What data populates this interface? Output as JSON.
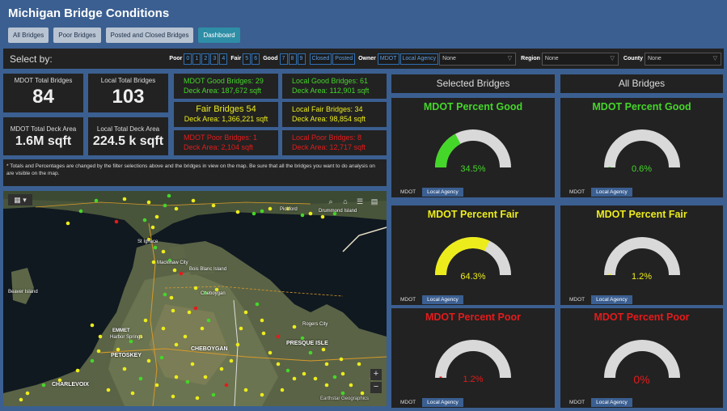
{
  "title": "Michigan Bridge Conditions",
  "tabs": [
    "All Bridges",
    "Poor Bridges",
    "Posted and Closed Bridges",
    "Dashboard"
  ],
  "select_bar": {
    "label": "Select by:",
    "poor_label": "Poor",
    "poor_values": [
      "0",
      "1",
      "2",
      "3",
      "4"
    ],
    "fair_label": "Fair",
    "fair_values": [
      "5",
      "6"
    ],
    "good_label": "Good",
    "good_values": [
      "7",
      "8",
      "9"
    ],
    "closed": "Closed",
    "posted": "Posted",
    "owner_label": "Owner",
    "owner_mdot": "MDOT",
    "owner_local": "Local Agency",
    "owner_select": "None",
    "region_label": "Region",
    "region_select": "None",
    "county_label": "County",
    "county_select": "None"
  },
  "stats": {
    "mdot_total_label": "MDOT Total Bridges",
    "mdot_total": "84",
    "local_total_label": "Local Total Bridges",
    "local_total": "103",
    "mdot_deck_label": "MDOT Total Deck Area",
    "mdot_deck": "1.6M sqft",
    "local_deck_label": "Local Total Deck Area",
    "local_deck": "224.5 k sqft"
  },
  "conditions": {
    "mdot_good": "MDOT Good Bridges: 29",
    "mdot_good_area": "Deck Area: 187,672 sqft",
    "local_good": "Local Good Bridges: 61",
    "local_good_area": "Deck Area: 112,901 sqft",
    "fair": "Fair Bridges 54",
    "fair_area": "Deck Area: 1,366,221 sqft",
    "local_fair": "Local Fair Bridges: 34",
    "local_fair_area": "Deck Area: 98,854 sqft",
    "mdot_poor": "MDOT Poor Bridges: 1",
    "mdot_poor_area": "Deck Area: 2,104 sqft",
    "local_poor": "Local Poor Bridges: 8",
    "local_poor_area": "Deck Area: 12,717 sqft"
  },
  "note": "* Totals and Percentages are changed by the filter selections above and the bridges in view on the map. Be sure that all the bridges you want to do analysis on are visible on the map.",
  "map": {
    "labels": [
      "EMMET",
      "PETOSKEY",
      "CHEBOYGAN",
      "CHARLEVOIX",
      "PRESQUE ISLE",
      "Mackinaw City",
      "St Ignace",
      "Bois Blanc Island",
      "Beaver Island",
      "Harbor Springs",
      "Rogers City",
      "Cheboygan",
      "Pickford",
      "Drummond Island"
    ],
    "attribution": "Earthstar Geographics",
    "zoom_in": "+",
    "zoom_out": "−"
  },
  "panels": {
    "selected": "Selected Bridges",
    "all": "All Bridges"
  },
  "gauge_tabs": {
    "mdot": "MDOT",
    "local": "Local Agency"
  },
  "gauges": [
    {
      "title": "MDOT Percent Good",
      "value": 34.5,
      "label": "34.5%",
      "color": "#45d62a"
    },
    {
      "title": "MDOT Percent Good",
      "value": 0.6,
      "label": "0.6%",
      "color": "#45d62a"
    },
    {
      "title": "MDOT Percent Fair",
      "value": 64.3,
      "label": "64.3%",
      "color": "#ecec1c"
    },
    {
      "title": "MDOT Percent Fair",
      "value": 1.2,
      "label": "1.2%",
      "color": "#ecec1c"
    },
    {
      "title": "MDOT Percent Poor",
      "value": 1.2,
      "label": "1.2%",
      "color": "#e41b1b"
    },
    {
      "title": "MDOT Percent Poor",
      "value": 0,
      "label": "0%",
      "color": "#e41b1b"
    }
  ],
  "colors": {
    "good": "#45d62a",
    "fair": "#ecec1c",
    "poor": "#e41b1b",
    "track": "#d9d9d9"
  }
}
